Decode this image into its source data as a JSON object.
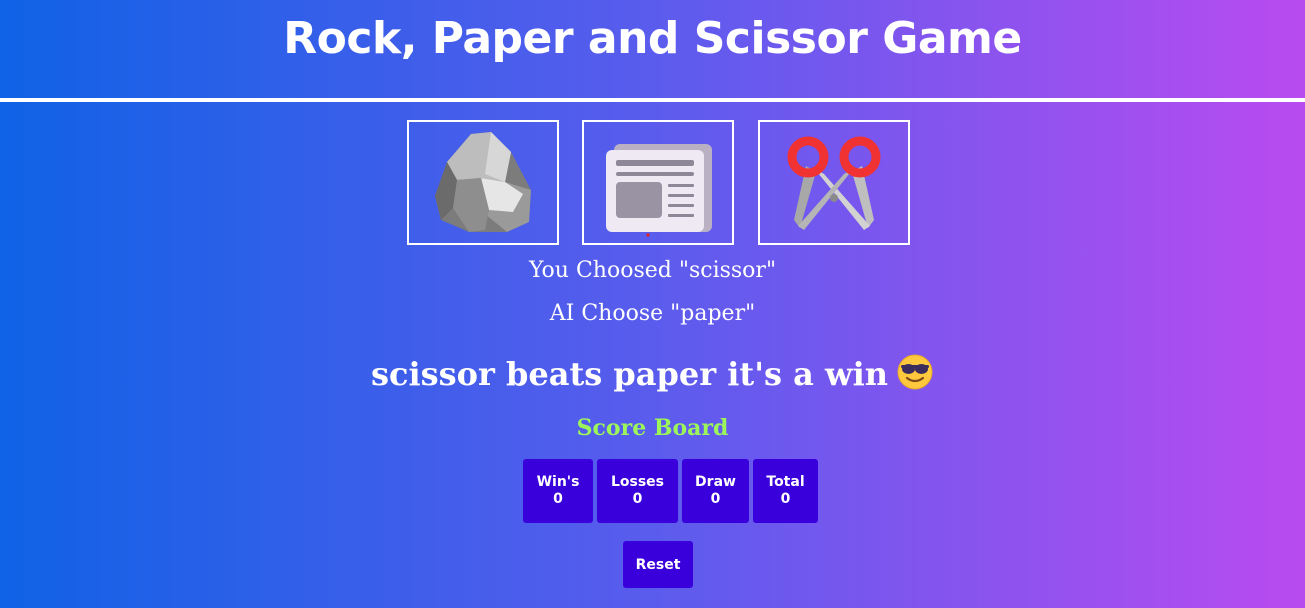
{
  "header": {
    "title": "Rock, Paper and Scissor Game"
  },
  "choices": [
    {
      "id": "rock",
      "icon": "rock-icon"
    },
    {
      "id": "paper",
      "icon": "newspaper-icon"
    },
    {
      "id": "scissor",
      "icon": "scissors-icon"
    }
  ],
  "status": {
    "user_choice": "You Choosed \"scissor\"",
    "ai_choice": "AI Choose \"paper\"",
    "result": "scissor beats paper it's a win",
    "result_emoji": "smiling-face-with-sunglasses-icon"
  },
  "scoreboard": {
    "title": "Score Board",
    "wins_label": "Win's",
    "wins_value": "0",
    "losses_label": "Losses",
    "losses_value": "0",
    "draw_label": "Draw",
    "draw_value": "0",
    "total_label": "Total",
    "total_value": "0"
  },
  "controls": {
    "reset_label": "Reset"
  },
  "colors": {
    "gradient_start": "#1062e6",
    "gradient_end": "#b94bf0",
    "button_bg": "#3a00dc",
    "score_title": "#9cf55a",
    "scissor_handle": "#f03232"
  }
}
